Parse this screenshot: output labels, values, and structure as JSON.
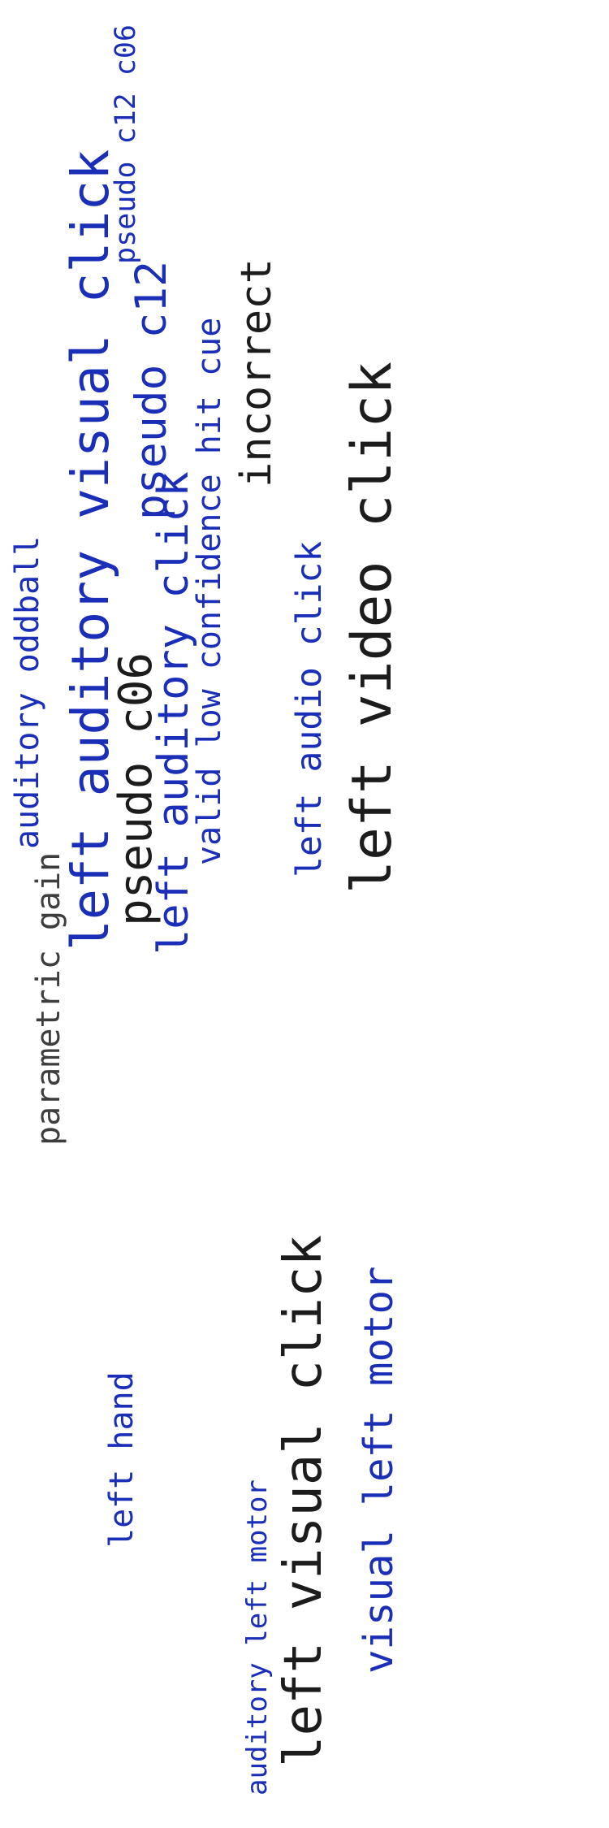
{
  "palette": {
    "black": "#1c1c1c",
    "gray": "#3d3d3d",
    "blue": "#1a2eb8"
  },
  "words": [
    "auditory oddball",
    "parametric gain",
    "left auditory visual click",
    "pseudo c12 c06",
    "pseudo c12",
    "valid low confidence hit cue",
    "incorrect",
    "pseudo c06",
    "left auditory click",
    "left audio click",
    "left video click",
    "left hand",
    "auditory left motor",
    "left visual click",
    "visual left motor"
  ]
}
